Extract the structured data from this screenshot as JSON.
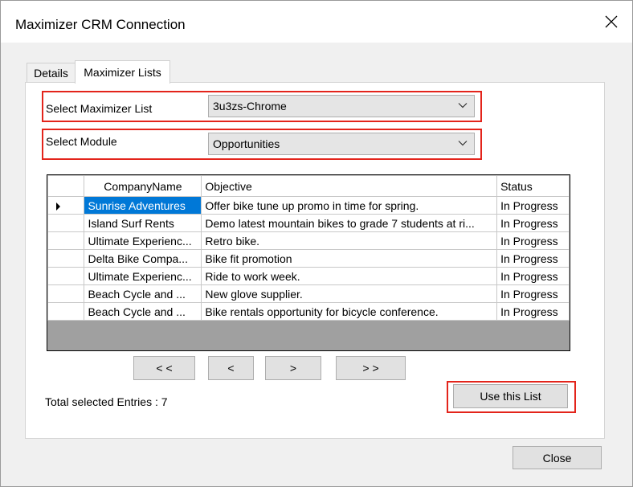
{
  "window": {
    "title": "Maximizer CRM Connection"
  },
  "tabs": [
    {
      "label": "Details"
    },
    {
      "label": "Maximizer Lists"
    }
  ],
  "list_select": {
    "label": "Select Maximizer List",
    "value": "3u3zs-Chrome"
  },
  "module_select": {
    "label": "Select Module",
    "value": "Opportunities"
  },
  "grid": {
    "columns": [
      "CompanyName",
      "Objective",
      "Status"
    ],
    "rows": [
      {
        "company": "Sunrise Adventures",
        "objective": "Offer bike tune up promo in time for spring.",
        "status": "In Progress"
      },
      {
        "company": "Island Surf Rents",
        "objective": "Demo latest mountain bikes to grade 7 students at ri...",
        "status": "In Progress"
      },
      {
        "company": "Ultimate Experienc...",
        "objective": "Retro bike.",
        "status": "In Progress"
      },
      {
        "company": "Delta Bike Compa...",
        "objective": "Bike fit promotion",
        "status": "In Progress"
      },
      {
        "company": "Ultimate Experienc...",
        "objective": "Ride to work week.",
        "status": "In Progress"
      },
      {
        "company": "Beach Cycle and ...",
        "objective": "New glove supplier.",
        "status": "In Progress"
      },
      {
        "company": "Beach Cycle and ...",
        "objective": "Bike rentals opportunity for bicycle conference.",
        "status": "In Progress"
      }
    ]
  },
  "pager": {
    "first": "< <",
    "prev": "<",
    "next": ">",
    "last": "> >"
  },
  "footer": {
    "total_label": "Total selected Entries : 7",
    "use_list": "Use this List",
    "close": "Close"
  },
  "colors": {
    "highlight": "#e3241b",
    "selection": "#0078d7"
  }
}
